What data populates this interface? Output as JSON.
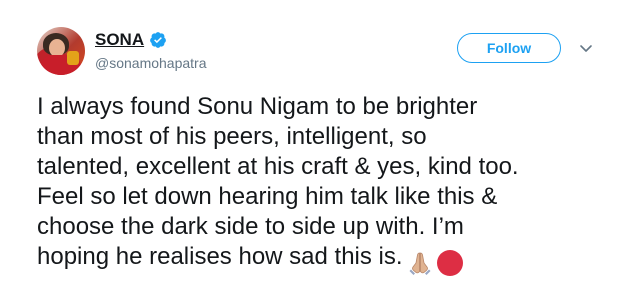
{
  "author": {
    "display_name": "SONA",
    "handle": "@sonamohapatra",
    "verified": true
  },
  "actions": {
    "follow_label": "Follow",
    "more_icon": "chevron-down-icon"
  },
  "tweet": {
    "lines": [
      "I always found Sonu Nigam to be brighter",
      "than most of his peers, intelligent, so",
      "talented, excellent at his craft & yes, kind too.",
      "Feel so let down hearing him talk like this &",
      "choose the dark side to side up with. I’m",
      "hoping he realises how sad this is."
    ],
    "emojis": [
      "folded-hands-icon",
      "red-circle-icon"
    ]
  },
  "colors": {
    "accent": "#1da1f2",
    "text": "#14171a",
    "secondary_text": "#657786",
    "emoji_red": "#dd2e44",
    "emoji_skin": "#e0b391"
  }
}
